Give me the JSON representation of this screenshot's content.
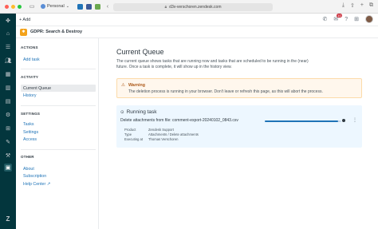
{
  "browser": {
    "profile_label": "Personal",
    "url": "d3v-verschoren.zendesk.com",
    "add_label": "+ Add"
  },
  "header": {
    "notification_count": "10"
  },
  "app": {
    "title": "GDPR: Search & Destroy"
  },
  "sidenav": {
    "sections": [
      {
        "title": "ACTIONS",
        "items": [
          "Add task"
        ]
      },
      {
        "title": "ACTIVITY",
        "items": [
          "Current Queue",
          "History"
        ]
      },
      {
        "title": "SETTINGS",
        "items": [
          "Tasks",
          "Settings",
          "Access"
        ]
      },
      {
        "title": "OTHER",
        "items": [
          "About",
          "Subscription",
          "Help Center ↗"
        ]
      }
    ],
    "active_item": "Current Queue"
  },
  "main": {
    "title": "Current Queue",
    "description": "The current queue shows tasks that are running now and tasks that are scheduled to be running in the (near) future. Once a task is complete, it will show up in the history view.",
    "warning": {
      "title": "Warning",
      "text": "The deletion process is running in your browser. Don't leave or refresh this page, as this will abort the process."
    },
    "running_task": {
      "heading": "Running task",
      "description": "Delete attachments from file: comment-export-20240102_0843.csv",
      "progress": 0.96,
      "meta": [
        {
          "label": "Product",
          "value": "Zendesk Support"
        },
        {
          "label": "Type",
          "value": "Attachments / Delete attachments"
        },
        {
          "label": "Executing at",
          "value": "Thomas Verschoren"
        }
      ]
    }
  },
  "colors": {
    "rail": "#03363d",
    "link": "#1f73b7",
    "warning_bg": "#fff7ed",
    "task_bg": "#edf7ff",
    "app_logo": "#f3a21a"
  }
}
